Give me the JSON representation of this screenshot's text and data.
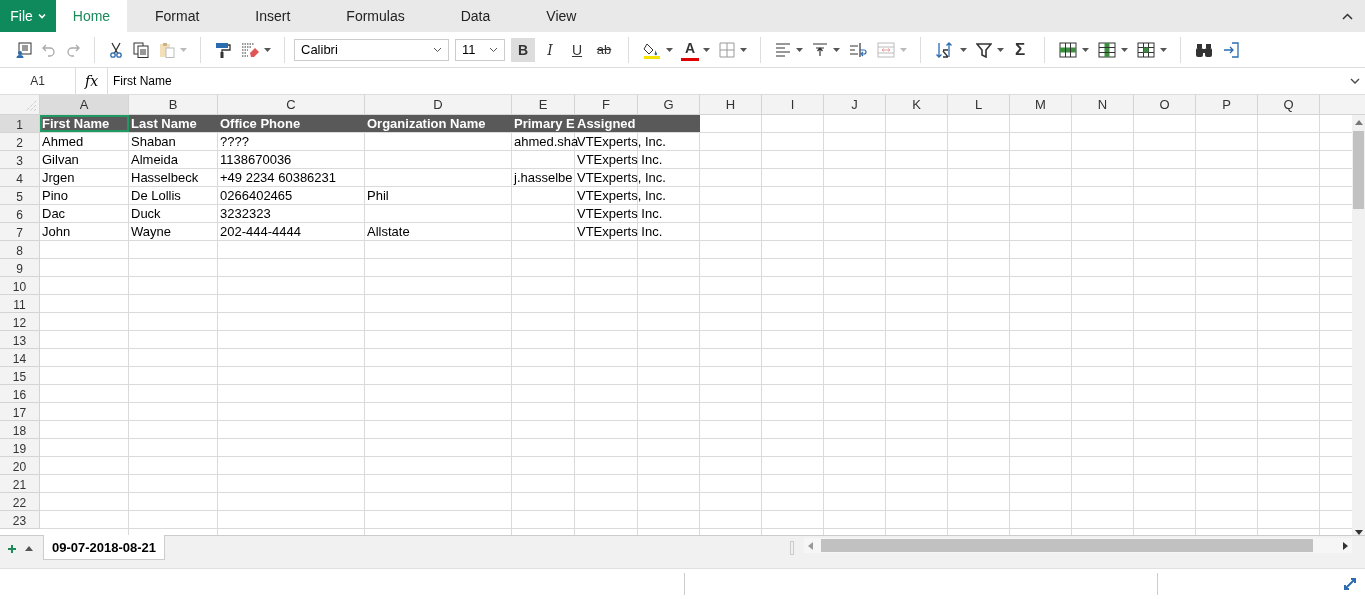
{
  "menu": {
    "file": "File",
    "tabs": [
      {
        "label": "Home",
        "selected": true
      },
      {
        "label": "Format",
        "selected": false
      },
      {
        "label": "Insert",
        "selected": false
      },
      {
        "label": "Formulas",
        "selected": false
      },
      {
        "label": "Data",
        "selected": false
      },
      {
        "label": "View",
        "selected": false
      }
    ]
  },
  "toolbar": {
    "font": "Calibri",
    "size": "11",
    "styles": [
      {
        "label": "B",
        "kind": "bold",
        "selected": true
      },
      {
        "label": "I",
        "kind": "italic",
        "selected": false
      },
      {
        "label": "U",
        "kind": "underline",
        "selected": false
      },
      {
        "label": "ab",
        "kind": "strike",
        "selected": false
      }
    ],
    "font_color": "A",
    "sum": "Σ"
  },
  "formula_bar": {
    "cell": "A1",
    "fx": "fx",
    "value": "First Name"
  },
  "columns": [
    {
      "label": "A",
      "selected": true
    },
    {
      "label": "B",
      "selected": false
    },
    {
      "label": "C",
      "selected": false
    },
    {
      "label": "D",
      "selected": false
    },
    {
      "label": "E",
      "selected": false
    },
    {
      "label": "F",
      "selected": false
    },
    {
      "label": "G",
      "selected": false
    },
    {
      "label": "H",
      "selected": false
    },
    {
      "label": "I",
      "selected": false
    },
    {
      "label": "J",
      "selected": false
    },
    {
      "label": "K",
      "selected": false
    },
    {
      "label": "L",
      "selected": false
    },
    {
      "label": "M",
      "selected": false
    },
    {
      "label": "N",
      "selected": false
    },
    {
      "label": "O",
      "selected": false
    },
    {
      "label": "P",
      "selected": false
    },
    {
      "label": "Q",
      "selected": false
    }
  ],
  "rows": [
    {
      "number": "1",
      "selected": true,
      "kind": "header",
      "cells": {
        "A": "First Name",
        "B": "Last Name",
        "C": "Office Phone",
        "D": "Organization Name",
        "E": "Primary E",
        "F": "Assigned"
      }
    },
    {
      "number": "2",
      "selected": false,
      "kind": "data",
      "cells": {
        "A": "Ahmed",
        "B": "Shaban",
        "C": "????",
        "E": "ahmed.sha",
        "F": "VTExperts, Inc."
      }
    },
    {
      "number": "3",
      "selected": false,
      "kind": "data",
      "cells": {
        "A": "Gilvan",
        "B": "Almeida",
        "C": "1138670036",
        "F": "VTExperts Inc."
      }
    },
    {
      "number": "4",
      "selected": false,
      "kind": "data",
      "cells": {
        "A": "Jrgen",
        "B": "Hasselbeck",
        "C": "+49 2234 60386231",
        "E": "j.hasselbe",
        "F": "VTExperts, Inc."
      }
    },
    {
      "number": "5",
      "selected": false,
      "kind": "data",
      "cells": {
        "A": "Pino",
        "B": "De Lollis",
        "C": "0266402465",
        "D": "Phil",
        "F": "VTExperts, Inc."
      }
    },
    {
      "number": "6",
      "selected": false,
      "kind": "data",
      "cells": {
        "A": "Dac",
        "B": "Duck",
        "C": "3232323",
        "F": "VTExperts Inc."
      }
    },
    {
      "number": "7",
      "selected": false,
      "kind": "data",
      "cells": {
        "A": "John",
        "B": "Wayne",
        "C": "202-444-4444",
        "D": "Allstate",
        "F": "VTExperts Inc."
      }
    },
    {
      "number": "8",
      "selected": false,
      "kind": "data",
      "cells": {}
    },
    {
      "number": "9",
      "selected": false,
      "kind": "data",
      "cells": {}
    },
    {
      "number": "10",
      "selected": false,
      "kind": "data",
      "cells": {}
    },
    {
      "number": "11",
      "selected": false,
      "kind": "data",
      "cells": {}
    },
    {
      "number": "12",
      "selected": false,
      "kind": "data",
      "cells": {}
    },
    {
      "number": "13",
      "selected": false,
      "kind": "data",
      "cells": {}
    },
    {
      "number": "14",
      "selected": false,
      "kind": "data",
      "cells": {}
    },
    {
      "number": "15",
      "selected": false,
      "kind": "data",
      "cells": {}
    },
    {
      "number": "16",
      "selected": false,
      "kind": "data",
      "cells": {}
    },
    {
      "number": "17",
      "selected": false,
      "kind": "data",
      "cells": {}
    },
    {
      "number": "18",
      "selected": false,
      "kind": "data",
      "cells": {}
    },
    {
      "number": "19",
      "selected": false,
      "kind": "data",
      "cells": {}
    },
    {
      "number": "20",
      "selected": false,
      "kind": "data",
      "cells": {}
    },
    {
      "number": "21",
      "selected": false,
      "kind": "data",
      "cells": {}
    },
    {
      "number": "22",
      "selected": false,
      "kind": "data",
      "cells": {}
    },
    {
      "number": "23",
      "selected": false,
      "kind": "data",
      "cells": {}
    }
  ],
  "sheets": [
    {
      "label": "09-07-2018-08-21",
      "selected": true
    }
  ]
}
